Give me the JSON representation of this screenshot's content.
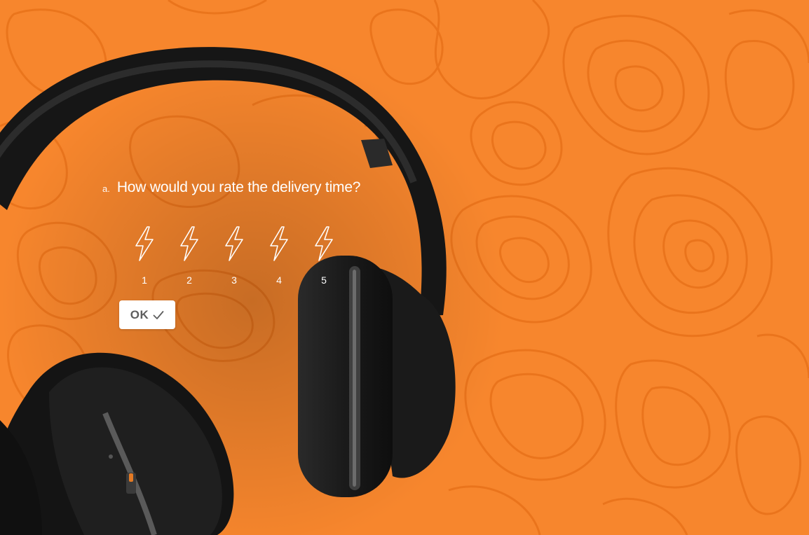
{
  "question": {
    "prefix": "a.",
    "text": "How would you rate the delivery time?"
  },
  "rating": {
    "icon": "lightning-bolt-icon",
    "options": [
      "1",
      "2",
      "3",
      "4",
      "5"
    ]
  },
  "ok_button": {
    "label": "OK",
    "icon": "checkmark-icon"
  },
  "colors": {
    "background": "#f7862d",
    "contour": "#e86f14",
    "text": "#ffffff",
    "button_text": "#5e5e5e"
  }
}
